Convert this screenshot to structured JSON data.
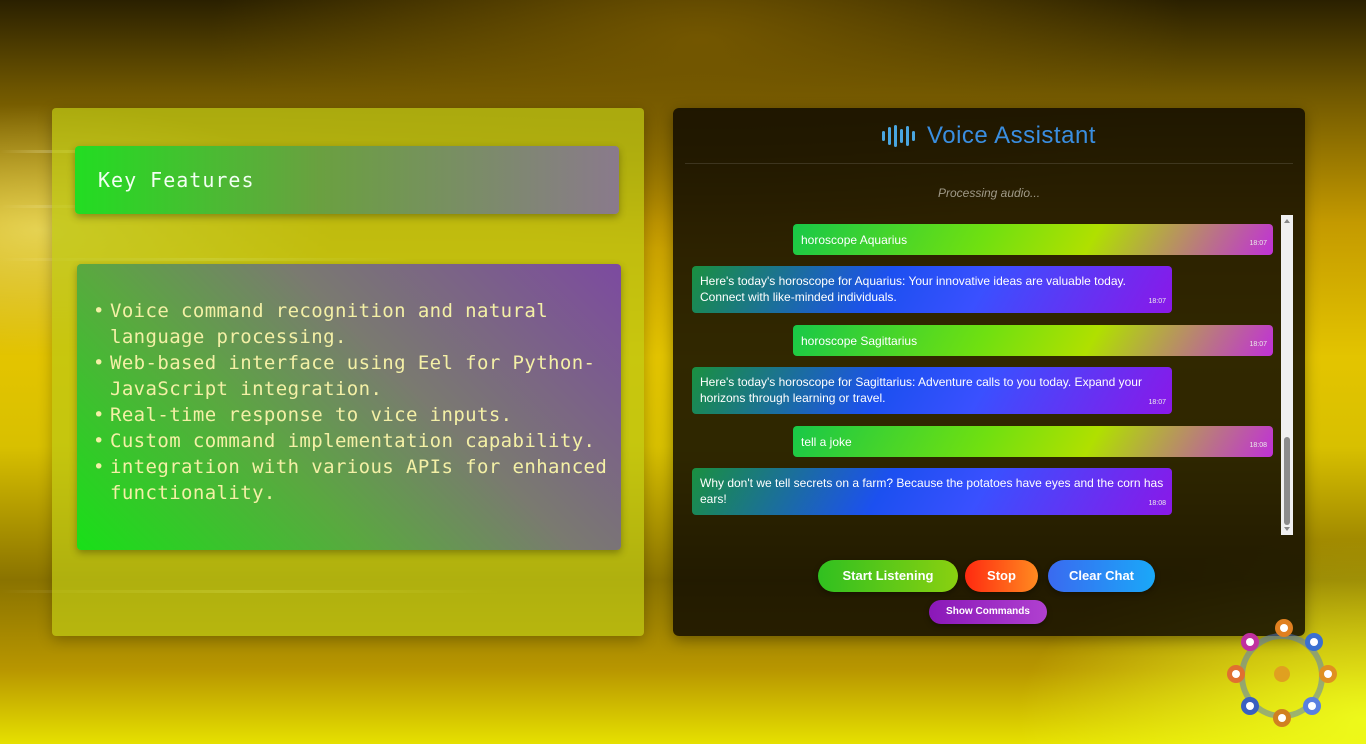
{
  "features": {
    "title": "Key Features",
    "items": [
      "Voice command recognition and natural language processing.",
      "Web-based interface using Eel for Python-JavaScript integration.",
      "Real-time response to vice inputs.",
      "Custom command implementation capability.",
      "integration with various APIs for enhanced functionality."
    ]
  },
  "assistant": {
    "title": "Voice Assistant",
    "status": "Processing audio...",
    "messages": [
      {
        "sender": "user",
        "text": "horoscope Aquarius",
        "time": "18:07"
      },
      {
        "sender": "bot",
        "text": "Here's today's horoscope for Aquarius: Your innovative ideas are valuable today. Connect with like-minded individuals.",
        "time": "18:07"
      },
      {
        "sender": "user",
        "text": "horoscope Sagittarius",
        "time": "18:07"
      },
      {
        "sender": "bot",
        "text": "Here's today's horoscope for Sagittarius: Adventure calls to you today. Expand your horizons through learning or travel.",
        "time": "18:07"
      },
      {
        "sender": "user",
        "text": "tell a joke",
        "time": "18:08"
      },
      {
        "sender": "bot",
        "text": "Why don't we tell secrets on a farm? Because the potatoes have eyes and the corn has ears!",
        "time": "18:08"
      }
    ],
    "buttons": {
      "start": "Start Listening",
      "stop": "Stop",
      "clear": "Clear Chat",
      "commands": "Show Commands"
    }
  },
  "colors": {
    "title_blue": "#3a8ee0",
    "stop_orange": "#ff4a10",
    "commands_purple": "#9a28c0"
  }
}
